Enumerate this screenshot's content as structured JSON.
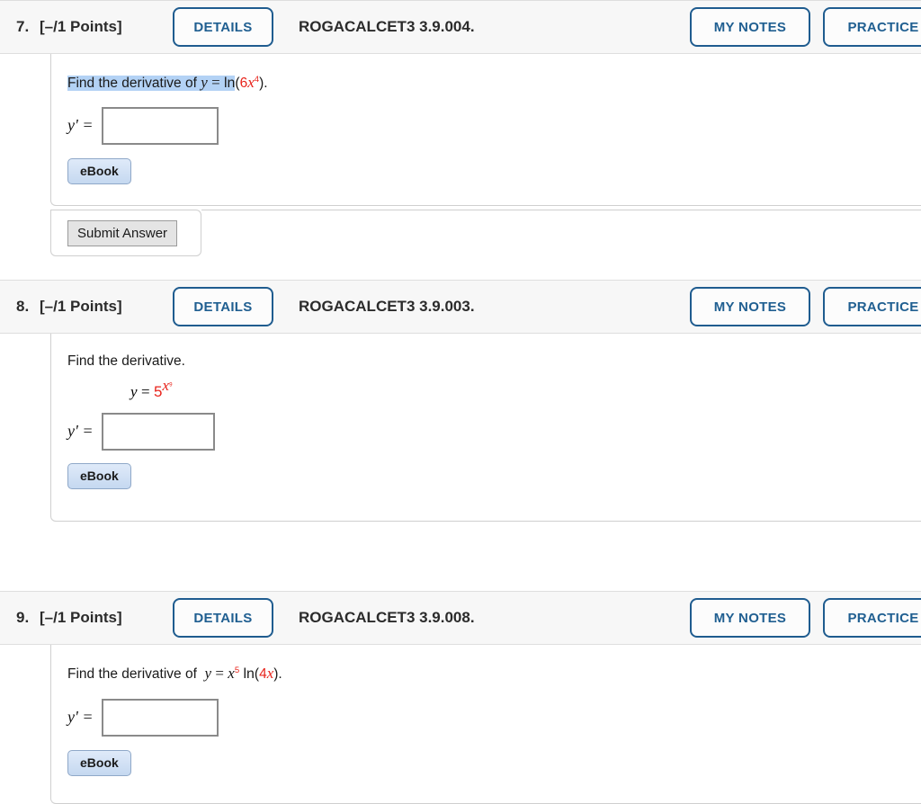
{
  "questions": [
    {
      "number": "7.",
      "points": "[–/1 Points]",
      "details_label": "DETAILS",
      "title": "ROGACALCET3 3.9.004.",
      "my_notes_label": "MY NOTES",
      "practice_label": "PRACTICE",
      "prompt_text": "Find the derivative of",
      "formula": "y = ln(6x⁴).",
      "answer_label": "y' =",
      "answer_value": "",
      "ebook_label": "eBook",
      "submit_label": "Submit Answer",
      "has_submit": true
    },
    {
      "number": "8.",
      "points": "[–/1 Points]",
      "details_label": "DETAILS",
      "title": "ROGACALCET3 3.9.003.",
      "my_notes_label": "MY NOTES",
      "practice_label": "PRACTICE",
      "prompt_text": "Find the derivative.",
      "formula": "y = 5^(x^9)",
      "answer_label": "y' =",
      "answer_value": "",
      "ebook_label": "eBook",
      "has_submit": false
    },
    {
      "number": "9.",
      "points": "[–/1 Points]",
      "details_label": "DETAILS",
      "title": "ROGACALCET3 3.9.008.",
      "my_notes_label": "MY NOTES",
      "practice_label": "PRACTICE",
      "prompt_text": "Find the derivative of",
      "formula": "y = x⁵ ln(4x).",
      "answer_label": "y' =",
      "answer_value": "",
      "ebook_label": "eBook",
      "has_submit": false
    }
  ],
  "colors": {
    "accent_blue": "#205f91",
    "math_red": "#e8241c",
    "selection_highlight": "#b3d2f5",
    "header_background": "#f7f7f7"
  }
}
